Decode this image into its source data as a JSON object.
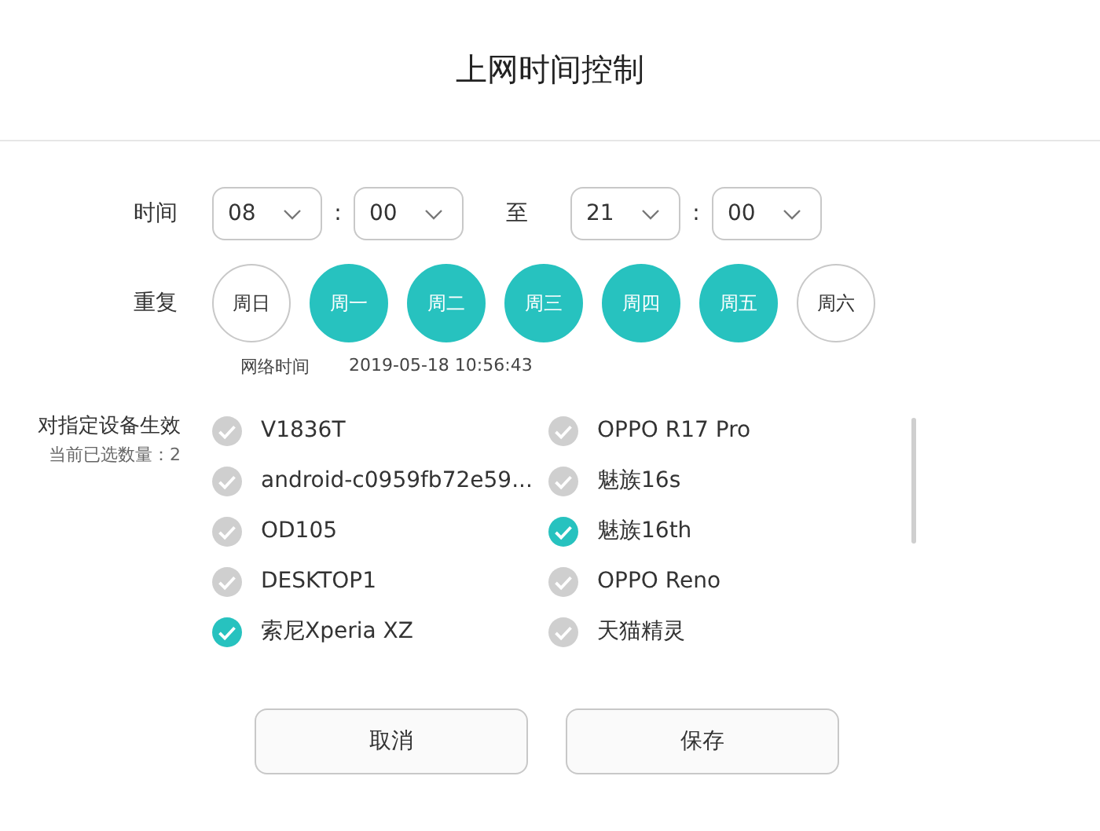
{
  "dialog": {
    "title": "上网时间控制"
  },
  "time": {
    "label": "时间",
    "start_hour": "08",
    "start_minute": "00",
    "separator_1": ":",
    "to": "至",
    "end_hour": "21",
    "end_minute": "00",
    "separator_2": ":"
  },
  "repeat": {
    "label": "重复",
    "days": [
      {
        "label": "周日",
        "selected": false
      },
      {
        "label": "周一",
        "selected": true
      },
      {
        "label": "周二",
        "selected": true
      },
      {
        "label": "周三",
        "selected": true
      },
      {
        "label": "周四",
        "selected": true
      },
      {
        "label": "周五",
        "selected": true
      },
      {
        "label": "周六",
        "selected": false
      }
    ]
  },
  "network_time": {
    "label": "网络时间",
    "value": "2019-05-18 10:56:43"
  },
  "devices": {
    "label": "对指定设备生效",
    "count": "当前已选数量：2",
    "items": [
      {
        "name": "V1836T",
        "checked": false
      },
      {
        "name": "OPPO R17 Pro",
        "checked": false
      },
      {
        "name": "android-c0959fb72e59...",
        "checked": false
      },
      {
        "name": "魅族16s",
        "checked": false
      },
      {
        "name": "OD105",
        "checked": false
      },
      {
        "name": "魅族16th",
        "checked": true
      },
      {
        "name": "DESKTOP1",
        "checked": false
      },
      {
        "name": "OPPO Reno",
        "checked": false
      },
      {
        "name": "索尼Xperia XZ",
        "checked": true
      },
      {
        "name": "天猫精灵",
        "checked": false
      }
    ]
  },
  "buttons": [
    {
      "label": "取消"
    },
    {
      "label": "保存"
    }
  ]
}
